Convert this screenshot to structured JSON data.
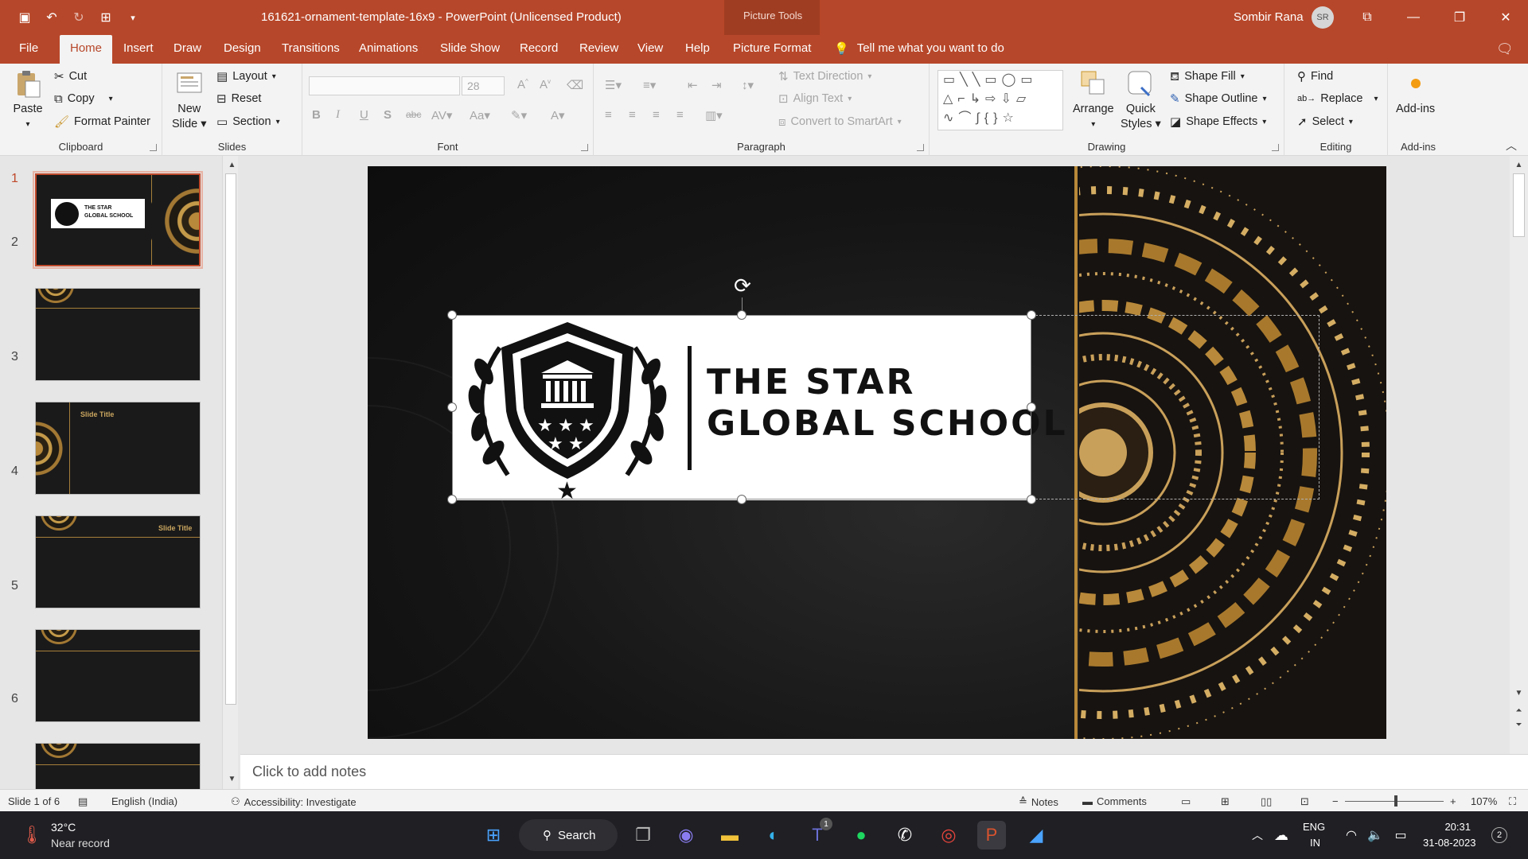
{
  "app": {
    "doc_title": "161621-ornament-template-16x9  -  PowerPoint (Unlicensed Product)",
    "context_tab_group": "Picture Tools",
    "user_name": "Sombir Rana",
    "user_initials": "SR"
  },
  "tabs": [
    "File",
    "Home",
    "Insert",
    "Draw",
    "Design",
    "Transitions",
    "Animations",
    "Slide Show",
    "Record",
    "Review",
    "View",
    "Help",
    "Picture Format"
  ],
  "active_tab": "Home",
  "tell_me": "Tell me what you want to do",
  "ribbon": {
    "clipboard": {
      "label": "Clipboard",
      "paste": "Paste",
      "cut": "Cut",
      "copy": "Copy",
      "format_painter": "Format Painter"
    },
    "slides": {
      "label": "Slides",
      "new_slide_1": "New",
      "new_slide_2": "Slide",
      "layout": "Layout",
      "reset": "Reset",
      "section": "Section"
    },
    "font": {
      "label": "Font",
      "font_name": "",
      "font_size": "28"
    },
    "paragraph": {
      "label": "Paragraph",
      "text_direction": "Text Direction",
      "align_text": "Align Text",
      "convert_smartart": "Convert to SmartArt"
    },
    "drawing": {
      "label": "Drawing",
      "arrange": "Arrange",
      "quick_styles_1": "Quick",
      "quick_styles_2": "Styles",
      "shape_fill": "Shape Fill",
      "shape_outline": "Shape Outline",
      "shape_effects": "Shape Effects"
    },
    "editing": {
      "label": "Editing",
      "find": "Find",
      "replace": "Replace",
      "select": "Select"
    },
    "addins": {
      "label": "Add-ins",
      "button": "Add-ins"
    }
  },
  "thumbnails": [
    {
      "num": "1",
      "title": ""
    },
    {
      "num": "2",
      "title": ""
    },
    {
      "num": "3",
      "title": "Slide Title"
    },
    {
      "num": "4",
      "title": "Slide Title"
    },
    {
      "num": "5",
      "title": ""
    },
    {
      "num": "6",
      "title": ""
    }
  ],
  "thumb1_logo_text_1": "THE STAR",
  "thumb1_logo_text_2": "GLOBAL SCHOOL",
  "slide": {
    "logo_line1": "THE STAR",
    "logo_line2": "GLOBAL SCHOOL"
  },
  "notes_placeholder": "Click to add notes",
  "status": {
    "slide_counter": "Slide 1 of 6",
    "language": "English (India)",
    "accessibility": "Accessibility: Investigate",
    "notes": "Notes",
    "comments": "Comments",
    "zoom": "107%"
  },
  "taskbar": {
    "temp": "32°C",
    "weather": "Near record",
    "search": "Search",
    "teams_badge": "1",
    "lang1": "ENG",
    "lang2": "IN",
    "time": "20:31",
    "date": "31-08-2023",
    "notifications": "2"
  },
  "colors": {
    "accent": "#b7472a",
    "gold": "#b8893a"
  }
}
